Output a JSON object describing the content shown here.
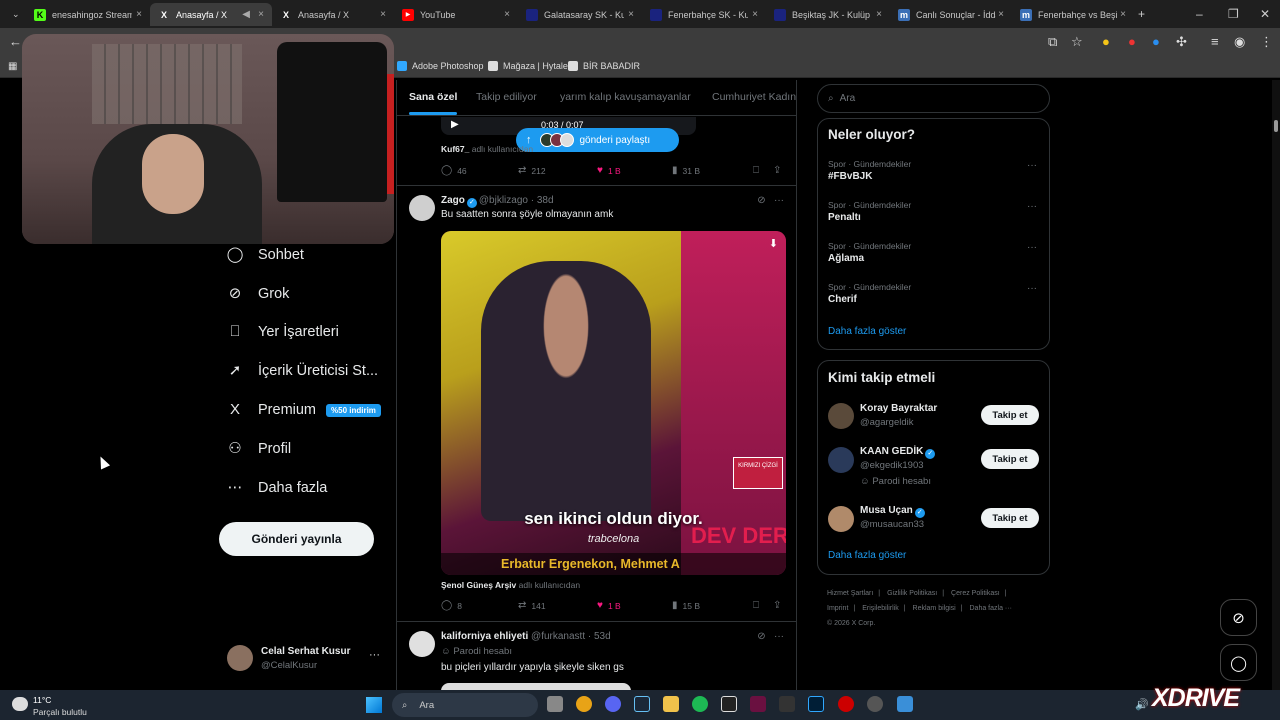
{
  "browser": {
    "tabs": [
      {
        "title": "enesahingoz Stream",
        "icon_color": "#53fc18",
        "active": false
      },
      {
        "title": "Anasayfa / X",
        "icon_color": "#000000",
        "active": true
      },
      {
        "title": "Anasayfa / X",
        "icon_color": "#000000",
        "active": false
      },
      {
        "title": "YouTube",
        "icon_color": "#ff0000",
        "active": false
      },
      {
        "title": "Galatasaray SK - Kulü",
        "icon_color": "#1a237e",
        "active": false
      },
      {
        "title": "Fenerbahçe SK - Kulü",
        "icon_color": "#1a237e",
        "active": false
      },
      {
        "title": "Beşiktaş JK - Kulüp p",
        "icon_color": "#1a237e",
        "active": false
      },
      {
        "title": "Canlı Sonuçlar - İdda",
        "icon_color": "#3b6fb6",
        "active": false
      },
      {
        "title": "Fenerbahçe vs Beşikt",
        "icon_color": "#3b6fb6",
        "active": false
      }
    ],
    "tab_x_glyph": "X",
    "tab_close": "×",
    "new_tab": "+",
    "window_controls": [
      "–",
      "❐",
      "✕"
    ],
    "bookmarks": [
      {
        "label": "Adobe Photoshop",
        "icon_color": "#31a8ff"
      },
      {
        "label": "Mağaza | Hytale",
        "icon_color": "#ffffff"
      },
      {
        "label": "BİR BABADIR",
        "icon_color": "#ffffff"
      }
    ]
  },
  "sidebar": {
    "items": [
      {
        "label": "Sohbet",
        "icon": "chat-icon",
        "glyph": "◯"
      },
      {
        "label": "Grok",
        "icon": "grok-icon",
        "glyph": "⊘"
      },
      {
        "label": "Yer İşaretleri",
        "icon": "bookmark-icon",
        "glyph": "⎕"
      },
      {
        "label": "İçerik Üreticisi St...",
        "icon": "rocket-icon",
        "glyph": "➚"
      },
      {
        "label": "Premium",
        "icon": "x-logo-icon",
        "glyph": "X"
      },
      {
        "label": "Profil",
        "icon": "person-icon",
        "glyph": "⚇"
      },
      {
        "label": "Daha fazla",
        "icon": "more-circle-icon",
        "glyph": "⋯"
      }
    ],
    "premium_badge": "%50 indirim",
    "post_button": "Gönderi yayınla",
    "profile": {
      "name": "Celal Serhat Kusur",
      "handle": "@CelalKusur",
      "more": "···"
    }
  },
  "timeline": {
    "tabs": [
      {
        "label": "Sana özel",
        "active": true
      },
      {
        "label": "Takip ediliyor",
        "active": false
      },
      {
        "label": "yarım kalıp kavuşamayanlar",
        "active": false
      },
      {
        "label": "Cumhuriyet Kadın",
        "active": false
      }
    ],
    "share_pill": {
      "arrow": "↑",
      "text": "gönderi paylaştı"
    },
    "player": {
      "time": "0:03 / 0:07",
      "play": "▶"
    },
    "first_tweet": {
      "attribution_user": "Kuf67_",
      "attribution_suffix": "adlı kullanıcıdan",
      "replies": "46",
      "reposts": "212",
      "likes": "1 B",
      "views": "31 B"
    },
    "second_tweet": {
      "name": "Zago",
      "handle": "@bjklizago",
      "time": "· 38d",
      "text": "Bu saatten sonra şöyle olmayanın amk",
      "video_subtitle": "sen ikinci oldun diyor.",
      "video_small": "trabcelona",
      "video_ticker": "Erbatur Ergenekon, Mehmet A",
      "video_corner": "DEV DER",
      "video_badge": "KIRMIZI ÇİZGİ",
      "attribution_user": "Şenol Güneş Arşiv",
      "attribution_suffix": "adlı kullanıcıdan",
      "replies": "8",
      "reposts": "141",
      "likes": "1 B",
      "views": "15 B"
    },
    "third_tweet": {
      "name": "kaliforniya ehliyeti",
      "handle": "@furkanastt",
      "time": "· 53d",
      "parody": "Parodi hesabı",
      "text": "bu piçleri yıllardır yapıyla şikeyle siken gs"
    },
    "action_icons": {
      "reply": "◯",
      "repost": "⇄",
      "like": "♥",
      "views": "▮",
      "bookmark": "⎕",
      "share": "⇪"
    },
    "tweet_icons": {
      "grok": "⊘",
      "more": "···"
    }
  },
  "right": {
    "search_placeholder": "Ara",
    "trends_title": "Neler oluyor?",
    "trends": [
      {
        "category": "Spor · Gündemdekiler",
        "name": "#FBvBJK"
      },
      {
        "category": "Spor · Gündemdekiler",
        "name": "Penaltı"
      },
      {
        "category": "Spor · Gündemdekiler",
        "name": "Ağlama"
      },
      {
        "category": "Spor · Gündemdekiler",
        "name": "Cherif"
      }
    ],
    "trends_more": "Daha fazla göster",
    "who_title": "Kimi takip etmeli",
    "who": [
      {
        "name": "Koray Bayraktar",
        "handle": "@agargeldik",
        "verified": false,
        "parody": "",
        "color": "#5a4a3a"
      },
      {
        "name": "KAAN GEDİK",
        "handle": "@ekgedik1903",
        "verified": true,
        "parody": "Parodi hesabı",
        "color": "#2a3a5a"
      },
      {
        "name": "Musa Uçan",
        "handle": "@musaucan33",
        "verified": true,
        "parody": "",
        "color": "#b08a6a"
      }
    ],
    "follow_label": "Takip et",
    "who_more": "Daha fazla göster",
    "footer": [
      "Hizmet Şartları",
      "|",
      "Gizlilik Politikası",
      "|",
      "Çerez Politikası",
      "|",
      "Imprint",
      "|",
      "Erişilebilirlik",
      "|",
      "Reklam bilgisi",
      "|",
      "Daha fazla ···",
      "© 2026 X Corp."
    ]
  },
  "taskbar": {
    "weather_temp": "11°C",
    "weather_desc": "Parçalı bulutlu",
    "search": "Ara",
    "watermark": "XDRIVE"
  }
}
